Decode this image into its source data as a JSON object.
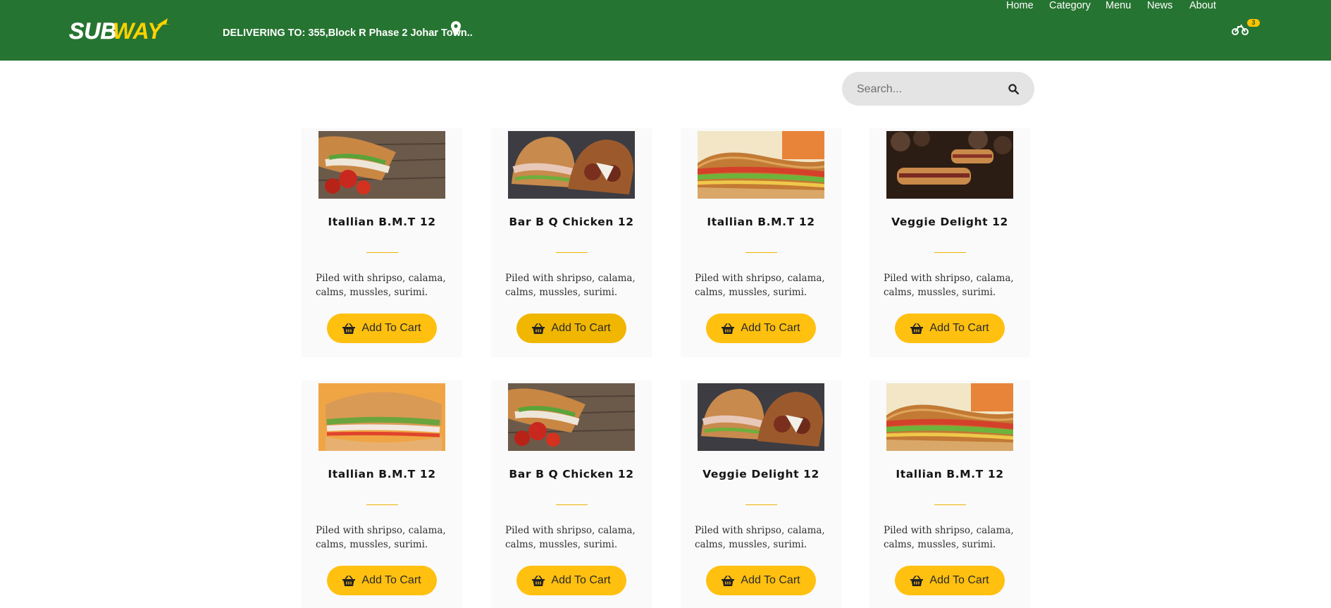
{
  "header": {
    "brand": "SUBWAY",
    "delivery_text": "DELIVERING TO: 355,Block R Phase 2 Johar Town..",
    "nav": [
      "Home",
      "Category",
      "Menu",
      "News",
      "About"
    ],
    "cart_count": "3",
    "location_icon": "map-pin-icon",
    "cart_icon": "motorbike-icon"
  },
  "search": {
    "placeholder": "Search...",
    "icon": "search-icon"
  },
  "colors": {
    "header": "#267431",
    "accent": "#ffc00f",
    "card_bg": "#fafafa"
  },
  "products": [
    {
      "name": "Itallian B.M.T 12",
      "description": "Piled with shripso, calama, calms, mussles, surimi.",
      "button": "Add To Cart"
    },
    {
      "name": "Bar B Q Chicken 12",
      "description": "Piled with shripso, calama, calms, mussles, surimi.",
      "button": "Add To Cart"
    },
    {
      "name": "Itallian B.M.T 12",
      "description": "Piled with shripso, calama, calms, mussles, surimi.",
      "button": "Add To Cart"
    },
    {
      "name": "Veggie Delight 12",
      "description": "Piled with shripso, calama, calms, mussles, surimi.",
      "button": "Add To Cart"
    },
    {
      "name": "Itallian B.M.T 12",
      "description": "Piled with shripso, calama, calms, mussles, surimi.",
      "button": "Add To Cart"
    },
    {
      "name": "Bar B Q Chicken 12",
      "description": "Piled with shripso, calama, calms, mussles, surimi.",
      "button": "Add To Cart"
    },
    {
      "name": "Veggie Delight 12",
      "description": "Piled with shripso, calama, calms, mussles, surimi.",
      "button": "Add To Cart"
    },
    {
      "name": "Itallian B.M.T 12",
      "description": "Piled with shripso, calama, calms, mussles, surimi.",
      "button": "Add To Cart"
    }
  ]
}
